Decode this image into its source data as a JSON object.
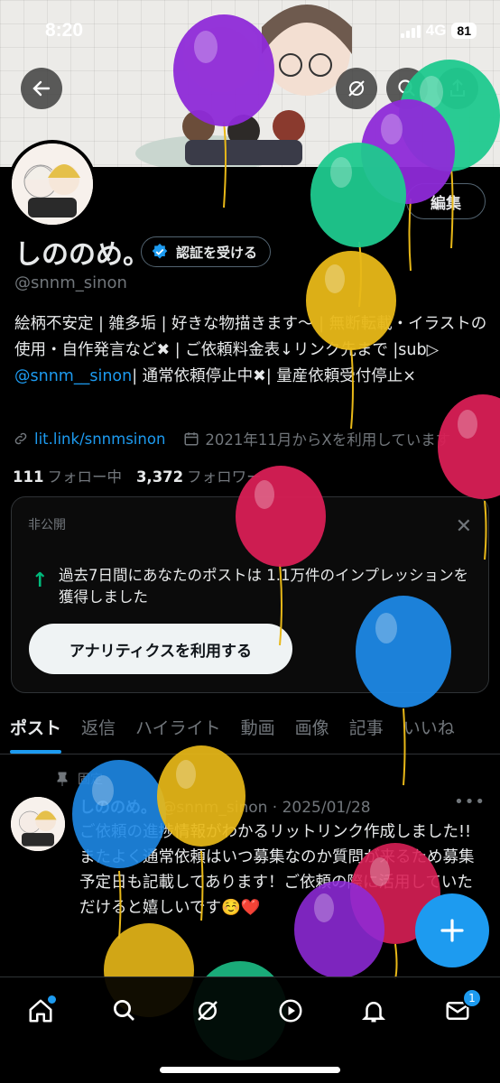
{
  "status_bar": {
    "time": "8:20",
    "network": "4G",
    "battery": "81"
  },
  "profile": {
    "display_name": "しののめ。",
    "verify_button": "認証を受ける",
    "handle": "@snnm_sinon",
    "edit_button": "編集",
    "bio_part1": "絵柄不安定 | 雑多垢 | 好きな物描きます〜 | 無断転載・イラストの使用・自作発言など✖ | ご依頼料金表↓リンク先まで |sub▷ ",
    "bio_mention": "@snnm__sinon",
    "bio_part2": "| 通常依頼停止中✖| 量産依頼受付停止×",
    "link": "lit.link/snnmsinon",
    "joined": "2021年11月からXを利用しています",
    "following_count": "111",
    "following_label": "フォロー中",
    "followers_count": "3,372",
    "followers_label": "フォロワー"
  },
  "analytics_card": {
    "label": "非公開",
    "text": "過去7日間にあなたのポストは 1.1万件のインプレッションを獲得しました",
    "button": "アナリティクスを利用する"
  },
  "tabs": [
    "ポスト",
    "返信",
    "ハイライト",
    "動画",
    "画像",
    "記事",
    "いいね"
  ],
  "post": {
    "pinned_label": "固定",
    "author": "しののめ。",
    "handle_date": "@snnm_sinon · 2025/01/28",
    "text": "ご依頼の進捗情報がわかるリットリンク作成しました!!\nまたよく通常依頼はいつ募集なのか質問が来るため募集予定日も記載してあります！ご依頼の際に活用していただけると嬉しいです☺️❤️"
  },
  "nav": {
    "messages_badge": "1"
  },
  "balloon_colors": [
    "#8e2ad8",
    "#1fc98e",
    "#e8b818",
    "#d81f55",
    "#1e88e5"
  ]
}
